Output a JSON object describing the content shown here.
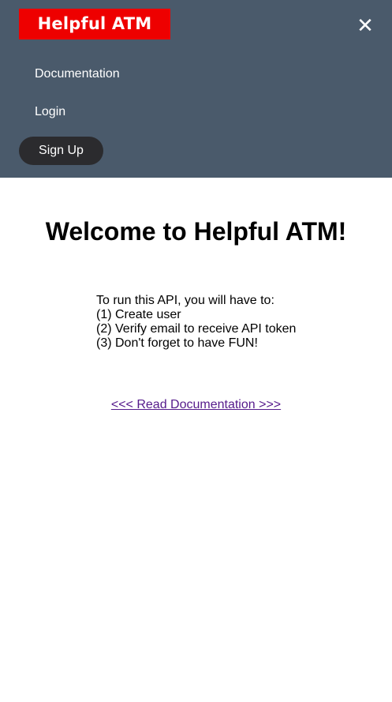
{
  "navbar": {
    "logo_text": "Helpful ATM",
    "close_icon": "close-icon",
    "close_glyph": "✕",
    "links": {
      "documentation": "Documentation",
      "login": "Login"
    },
    "signup_label": "Sign Up",
    "colors": {
      "background": "#4a5a6b",
      "logo_bg": "#ee0000",
      "signup_bg": "#2b2b2e"
    }
  },
  "main": {
    "title": "Welcome to Helpful ATM!",
    "instructions": [
      "To run this API, you will have to:",
      "(1) Create user",
      "(2) Verify email to receive API token",
      "(3) Don't forget to have FUN!"
    ],
    "docs_link": "<<< Read Documentation >>>"
  }
}
